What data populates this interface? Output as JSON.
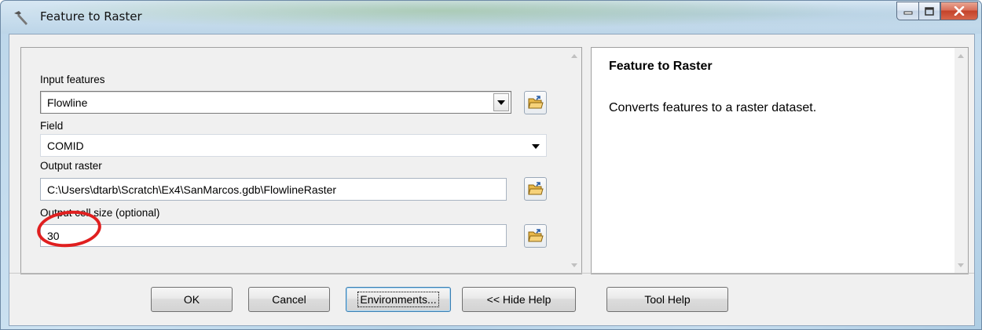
{
  "window": {
    "title": "Feature to Raster"
  },
  "params": {
    "input_features": {
      "label": "Input features",
      "value": "Flowline"
    },
    "field": {
      "label": "Field",
      "value": "COMID"
    },
    "output_raster": {
      "label": "Output raster",
      "value": "C:\\Users\\dtarb\\Scratch\\Ex4\\SanMarcos.gdb\\FlowlineRaster"
    },
    "cell_size": {
      "label": "Output cell size (optional)",
      "value": "30"
    }
  },
  "help": {
    "title": "Feature to Raster",
    "body": "Converts features to a raster dataset."
  },
  "buttons": {
    "ok": "OK",
    "cancel": "Cancel",
    "environments": "Environments...",
    "hide_help": "<< Hide Help",
    "tool_help": "Tool Help"
  },
  "icons": {
    "title": "hammer-icon",
    "browse": "open-folder-icon",
    "minimize": "minimize-icon",
    "maximize": "maximize-icon",
    "close": "close-icon"
  },
  "colors": {
    "annotation": "#e01f1f"
  }
}
